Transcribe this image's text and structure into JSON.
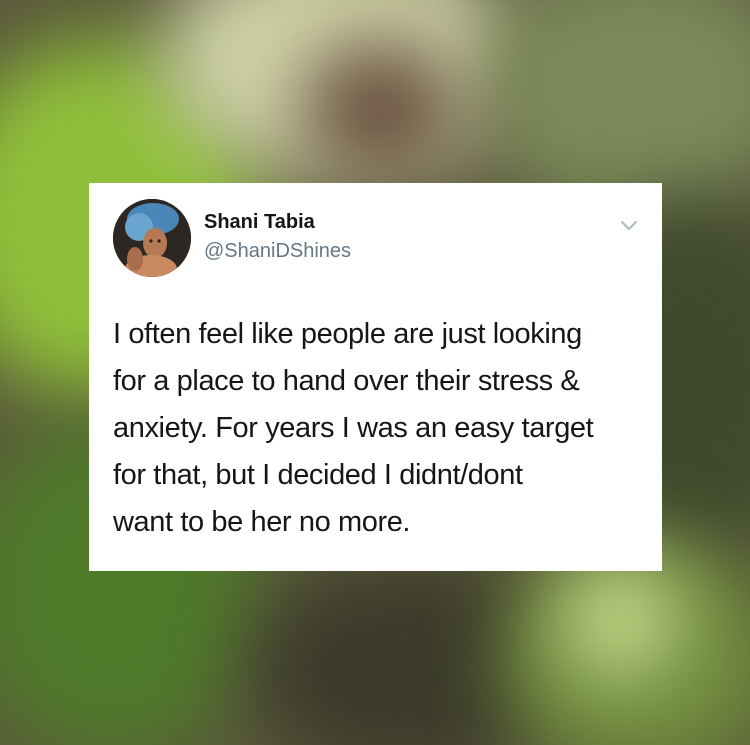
{
  "tweet": {
    "display_name": "Shani Tabia",
    "handle": "@ShaniDShines",
    "text_lines": [
      "I often feel like people are just looking",
      "for a place to hand over their stress &",
      "anxiety. For years I was an easy target",
      "for that, but I decided I didnt/dont",
      "want to be her no more."
    ],
    "menu_icon": "chevron-down-icon",
    "avatar_icon": "profile-photo"
  },
  "colors": {
    "card_background": "#ffffff",
    "name_text": "#14171a",
    "handle_text": "#657786",
    "chevron": "#aab8c2",
    "backdrop": "#5b5a3c"
  }
}
